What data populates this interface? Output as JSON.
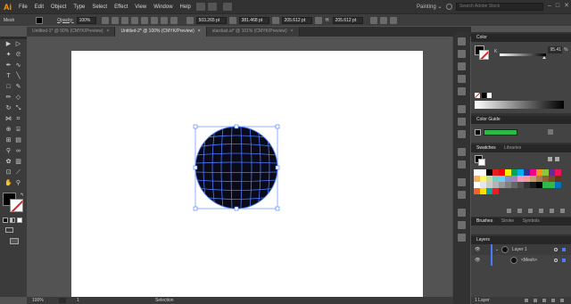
{
  "app": {
    "logo": "Ai"
  },
  "menu": [
    "File",
    "Edit",
    "Object",
    "Type",
    "Select",
    "Effect",
    "View",
    "Window",
    "Help"
  ],
  "workspace": {
    "label": "Painting",
    "arrow": "⌄"
  },
  "search": {
    "placeholder": "Search Adobe Stock"
  },
  "window_controls": [
    "–",
    "□",
    "✕"
  ],
  "control": {
    "selection_label": "Mesh",
    "opacity_label": "Opacity:",
    "opacity_value": "100%",
    "x_value": "503.265 pt",
    "y_value": "381.468 pt",
    "w_value": "205.612 pt",
    "h_label": "H:",
    "h_value": "205.612 pt"
  },
  "tabs": [
    {
      "label": "Untitled-1* @ 50% (CMYK/Preview)",
      "close": "×",
      "active": false
    },
    {
      "label": "Untitled-2* @ 100% (CMYK/Preview)",
      "close": "×",
      "active": true
    },
    {
      "label": "stardust.ai* @ 101% (CMYK/Preview)",
      "close": "×",
      "active": false
    }
  ],
  "status": {
    "zoom": "100%",
    "page": "1",
    "tool": "Selection"
  },
  "panels": {
    "color": {
      "title": "Color",
      "channel": "K",
      "value": "95.41",
      "unit": "%"
    },
    "color_guide": {
      "title": "Color Guide"
    },
    "swatches": {
      "tabs": [
        "Swatches",
        "Libraries"
      ]
    },
    "brushes": {
      "tabs": [
        "Brushes",
        "Stroke",
        "Symbols"
      ]
    },
    "layers": {
      "title": "Layers",
      "rows": [
        {
          "name": "Layer 1",
          "eye": "👁"
        },
        {
          "name": "<Mesh>",
          "eye": "👁"
        }
      ],
      "footer": "1 Layer"
    }
  },
  "colors": {
    "accent_mesh": "#4a7bff",
    "selection": "#4a7bff",
    "green_swatch": "#2fb84a"
  }
}
